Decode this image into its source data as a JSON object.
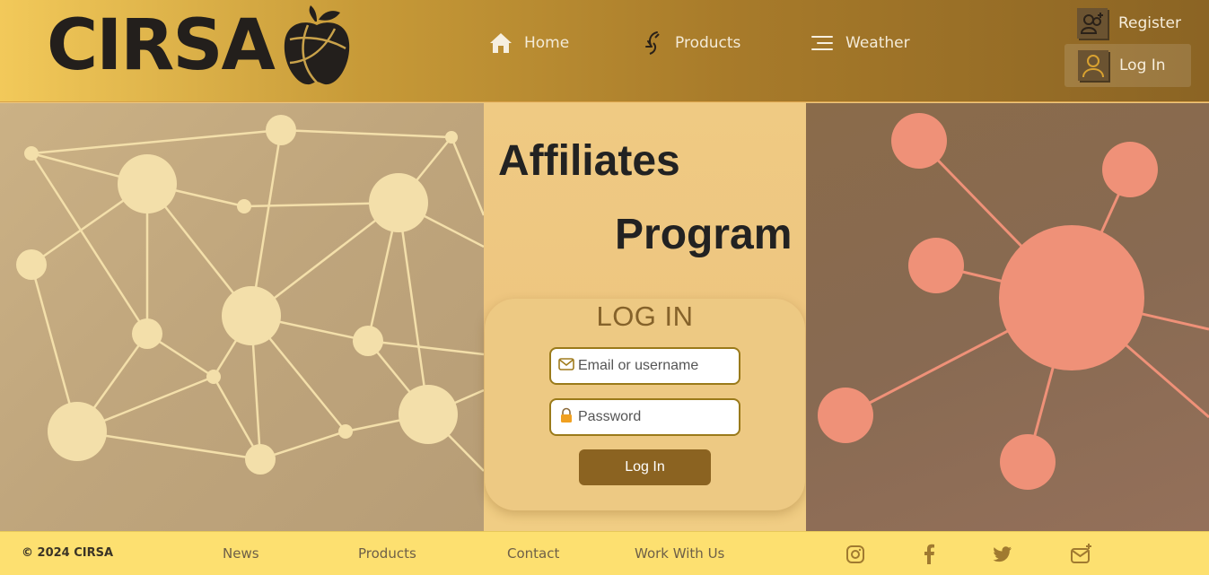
{
  "header": {
    "logo_text": "CIRSA",
    "nav": [
      {
        "label": "Home",
        "icon": "home-icon"
      },
      {
        "label": "Products",
        "icon": "products-icon"
      },
      {
        "label": "Weather",
        "icon": "menu-lines-icon"
      }
    ],
    "account": {
      "register_label": "Register",
      "login_label": "Log In"
    }
  },
  "main": {
    "title_line1": "Affiliates",
    "title_line2": "Program",
    "login": {
      "heading": "LOG IN",
      "email_placeholder": "Email or username",
      "password_placeholder": "Password",
      "submit_label": "Log In"
    }
  },
  "footer": {
    "copyright": "© 2024 CIRSA",
    "links": [
      "News",
      "Products",
      "Contact",
      "Work With Us"
    ],
    "social": [
      "instagram-icon",
      "facebook-icon",
      "twitter-icon",
      "mail-plus-icon"
    ]
  },
  "colors": {
    "header_start": "#f2c95a",
    "header_end": "#8b6424",
    "accent_brown": "#8b6321",
    "footer_bg": "#fde070",
    "node_light": "#f3dfaa",
    "node_coral": "#ef9178"
  }
}
